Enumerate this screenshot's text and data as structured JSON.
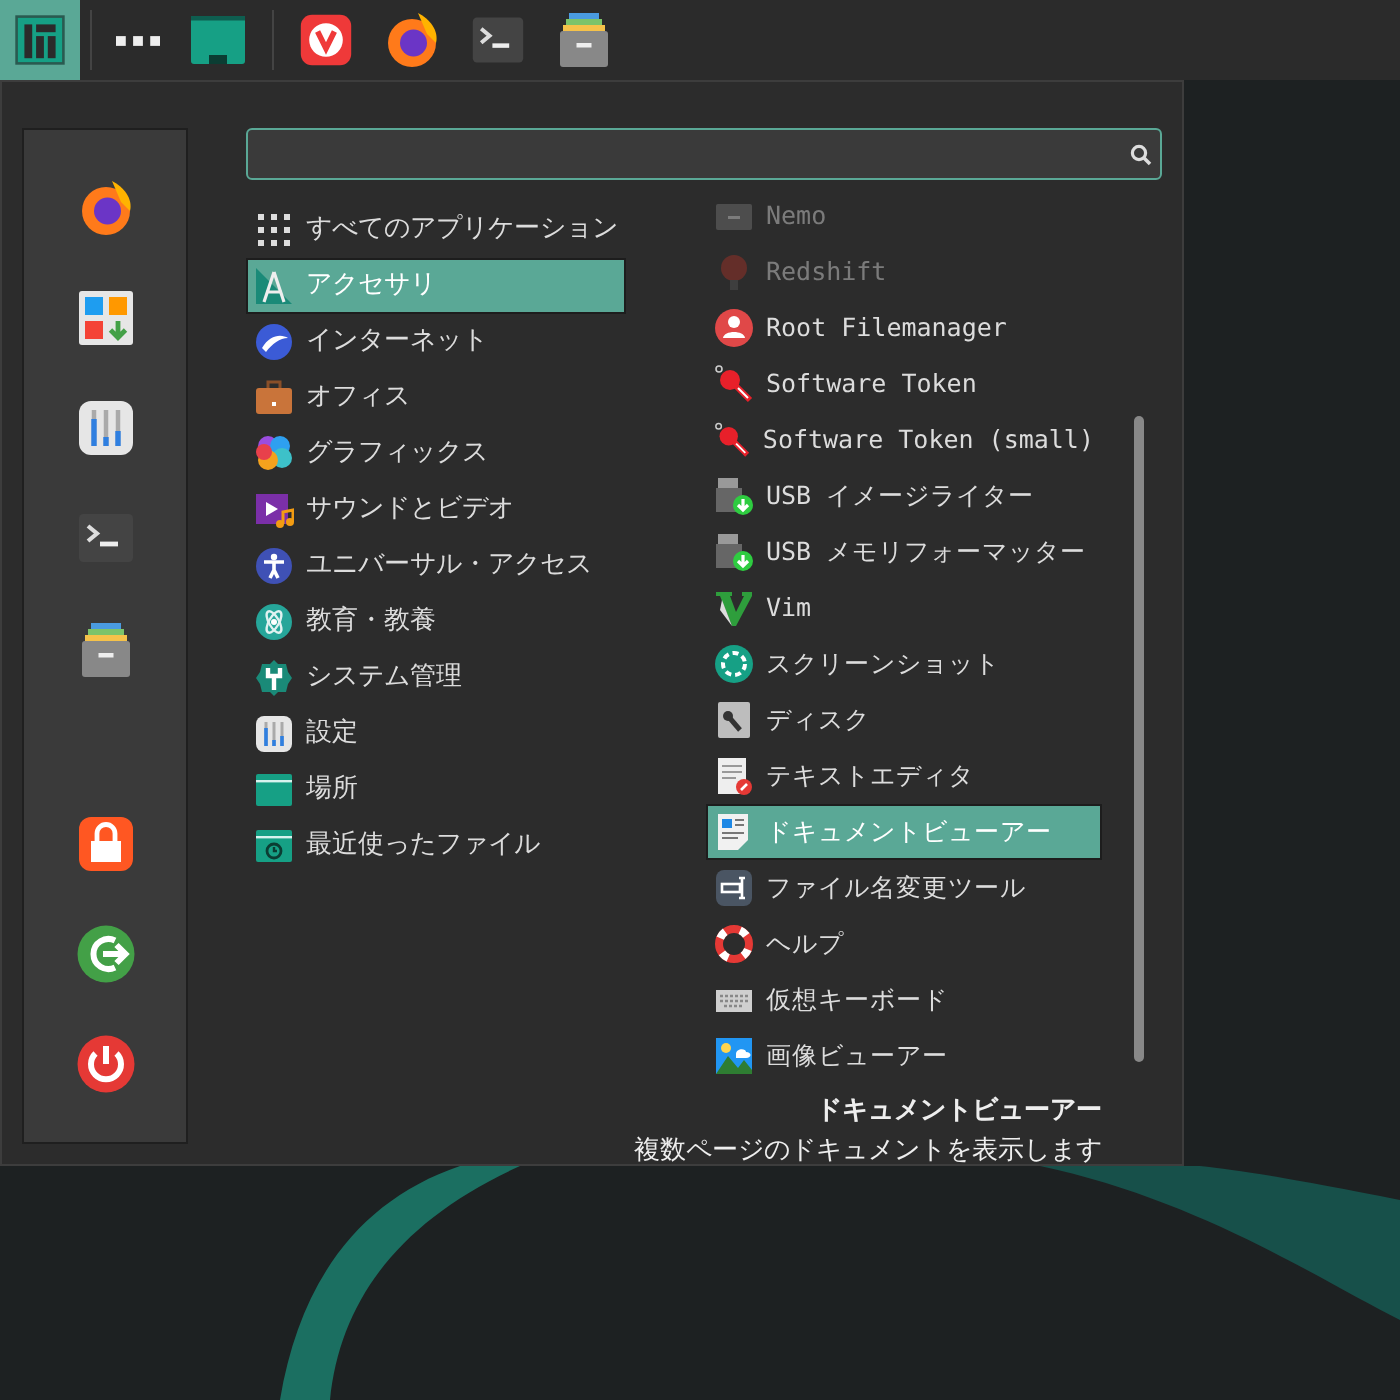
{
  "taskbar": {
    "start_button": {
      "selected": true
    }
  },
  "categories": [
    {
      "label": "すべてのアプリケーション",
      "selected": false
    },
    {
      "label": "アクセサリ",
      "selected": true
    },
    {
      "label": "インターネット",
      "selected": false
    },
    {
      "label": "オフィス",
      "selected": false
    },
    {
      "label": "グラフィックス",
      "selected": false
    },
    {
      "label": "サウンドとビデオ",
      "selected": false
    },
    {
      "label": "ユニバーサル・アクセス",
      "selected": false
    },
    {
      "label": "教育・教養",
      "selected": false
    },
    {
      "label": "システム管理",
      "selected": false
    },
    {
      "label": "設定",
      "selected": false
    },
    {
      "label": "場所",
      "selected": false
    },
    {
      "label": "最近使ったファイル",
      "selected": false
    }
  ],
  "apps": [
    {
      "label": "Nemo",
      "selected": false,
      "faded": true
    },
    {
      "label": "Redshift",
      "selected": false,
      "faded": true
    },
    {
      "label": "Root Filemanager",
      "selected": false,
      "faded": false
    },
    {
      "label": "Software Token",
      "selected": false,
      "faded": false
    },
    {
      "label": "Software Token (small)",
      "selected": false,
      "faded": false
    },
    {
      "label": "USB イメージライター",
      "selected": false,
      "faded": false
    },
    {
      "label": "USB メモリフォーマッター",
      "selected": false,
      "faded": false
    },
    {
      "label": "Vim",
      "selected": false,
      "faded": false
    },
    {
      "label": "スクリーンショット",
      "selected": false,
      "faded": false
    },
    {
      "label": "ディスク",
      "selected": false,
      "faded": false
    },
    {
      "label": "テキストエディタ",
      "selected": false,
      "faded": false
    },
    {
      "label": "ドキュメントビューアー",
      "selected": true,
      "faded": false
    },
    {
      "label": "ファイル名変更ツール",
      "selected": false,
      "faded": false
    },
    {
      "label": "ヘルプ",
      "selected": false,
      "faded": false
    },
    {
      "label": "仮想キーボード",
      "selected": false,
      "faded": false
    },
    {
      "label": "画像ビューアー",
      "selected": false,
      "faded": false
    }
  ],
  "footer": {
    "title": "ドキュメントビューアー",
    "description": "複数ページのドキュメントを表示します"
  }
}
